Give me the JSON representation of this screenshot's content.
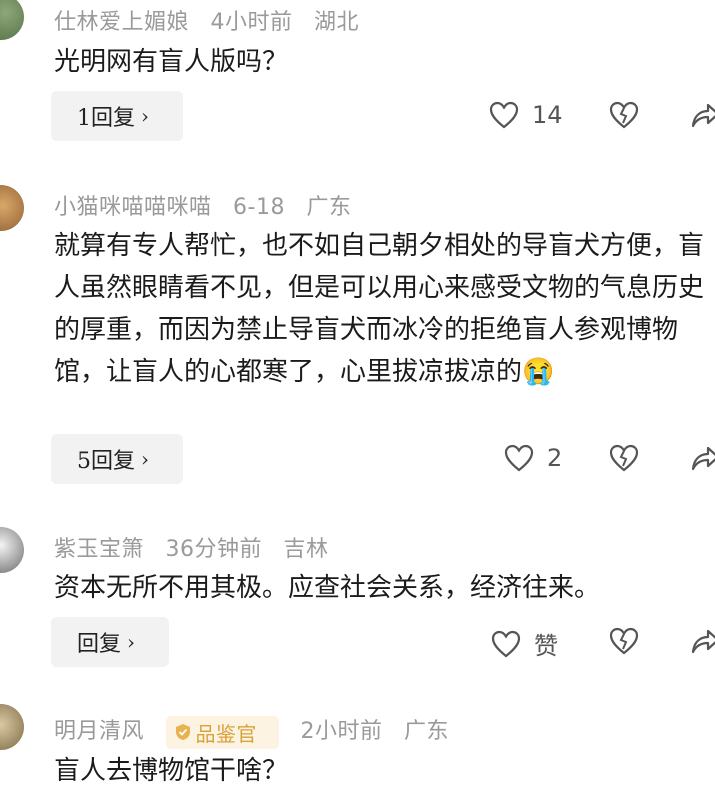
{
  "comments": [
    {
      "user": "仕林爱上媚娘",
      "time": "4小时前",
      "location": "湖北",
      "text": "光明网有盲人版吗？",
      "reply_label": "1回复",
      "like_count": "14"
    },
    {
      "user": "小猫咪喵喵咪喵",
      "time": "6-18",
      "location": "广东",
      "text": "就算有专人帮忙，也不如自己朝夕相处的导盲犬方便，盲人虽然眼睛看不见，但是可以用心来感受文物的气息历史的厚重，而因为禁止导盲犬而冰冷的拒绝盲人参观博物馆，让盲人的心都寒了，心里拔凉拔凉的",
      "emoji": "😭",
      "reply_label": "5回复",
      "like_count": "2"
    },
    {
      "user": "紫玉宝箫",
      "time": "36分钟前",
      "location": "吉林",
      "text": "资本无所不用其极。应查社会关系，经济往来。",
      "reply_label": "回复",
      "like_count": "赞"
    },
    {
      "user": "明月清风",
      "badge": "品鉴官",
      "time": "2小时前",
      "location": "广东",
      "text": "盲人去博物馆干啥？"
    }
  ],
  "icons": {
    "like": "heart-outline-icon",
    "dislike": "broken-heart-icon",
    "share": "share-arrow-icon",
    "reply_chevron": "chevron-right-icon",
    "badge": "shield-check-icon"
  },
  "colors": {
    "meta": "#9a9a9a",
    "badge_text": "#d9a23a",
    "badge_bg": "#fdf3e2",
    "reply_bg": "#f2f2f2"
  }
}
